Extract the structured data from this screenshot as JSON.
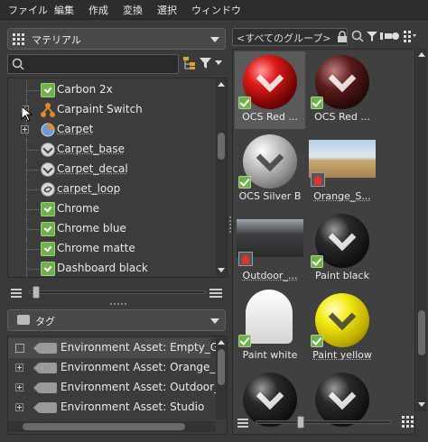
{
  "menu": [
    "ファイル",
    "編集",
    "作成",
    "変換",
    "選択",
    "ウィンドウ"
  ],
  "left_panel": {
    "type_dropdown": "マテリアル",
    "search_placeholder": "",
    "materials": [
      {
        "label": "Carbon 2x",
        "icon": "material-check-icon",
        "link": false
      },
      {
        "label": "Carpaint Switch",
        "icon": "switch-node-icon",
        "link": false
      },
      {
        "label": "Carpet",
        "icon": "multi-material-icon",
        "link": true
      },
      {
        "label": "Carpet_base",
        "icon": "vray-circle-icon",
        "link": true
      },
      {
        "label": "Carpet_decal",
        "icon": "vray-circle-icon",
        "link": true
      },
      {
        "label": "carpet_loop",
        "icon": "loop-circle-icon",
        "link": true
      },
      {
        "label": "Chrome",
        "icon": "material-check-icon",
        "link": false
      },
      {
        "label": "Chrome blue",
        "icon": "material-check-icon",
        "link": false
      },
      {
        "label": "Chrome matte",
        "icon": "material-check-icon",
        "link": false
      },
      {
        "label": "Dashboard black",
        "icon": "material-check-icon",
        "link": false
      }
    ],
    "tag_dropdown": "タグ",
    "tags": [
      "Environment Asset: Empty_Garage",
      "Environment Asset: Orange_Seavie",
      "Environment Asset: Outdoor_Stag",
      "Environment Asset: Studio"
    ]
  },
  "right_panel": {
    "group_selector": "<すべてのグループ>",
    "tiles": [
      {
        "label": "OCS Red ...",
        "style": "red",
        "selected": true
      },
      {
        "label": "OCS Red ...",
        "style": "redm",
        "selected": false
      },
      {
        "label": "OCS Silver B",
        "style": "silver",
        "selected": false
      },
      {
        "label": "Orange_S...",
        "style": "desert",
        "selected": false
      },
      {
        "label": "Outdoor_...",
        "style": "darkenv",
        "selected": false
      },
      {
        "label": "Paint black",
        "style": "black",
        "selected": false
      },
      {
        "label": "Paint white",
        "style": "white",
        "selected": false
      },
      {
        "label": "Paint yellow",
        "style": "yellow",
        "selected": false
      }
    ]
  },
  "colors": {
    "background": "#3a3a3a",
    "accent_green": "#6fb04c"
  }
}
